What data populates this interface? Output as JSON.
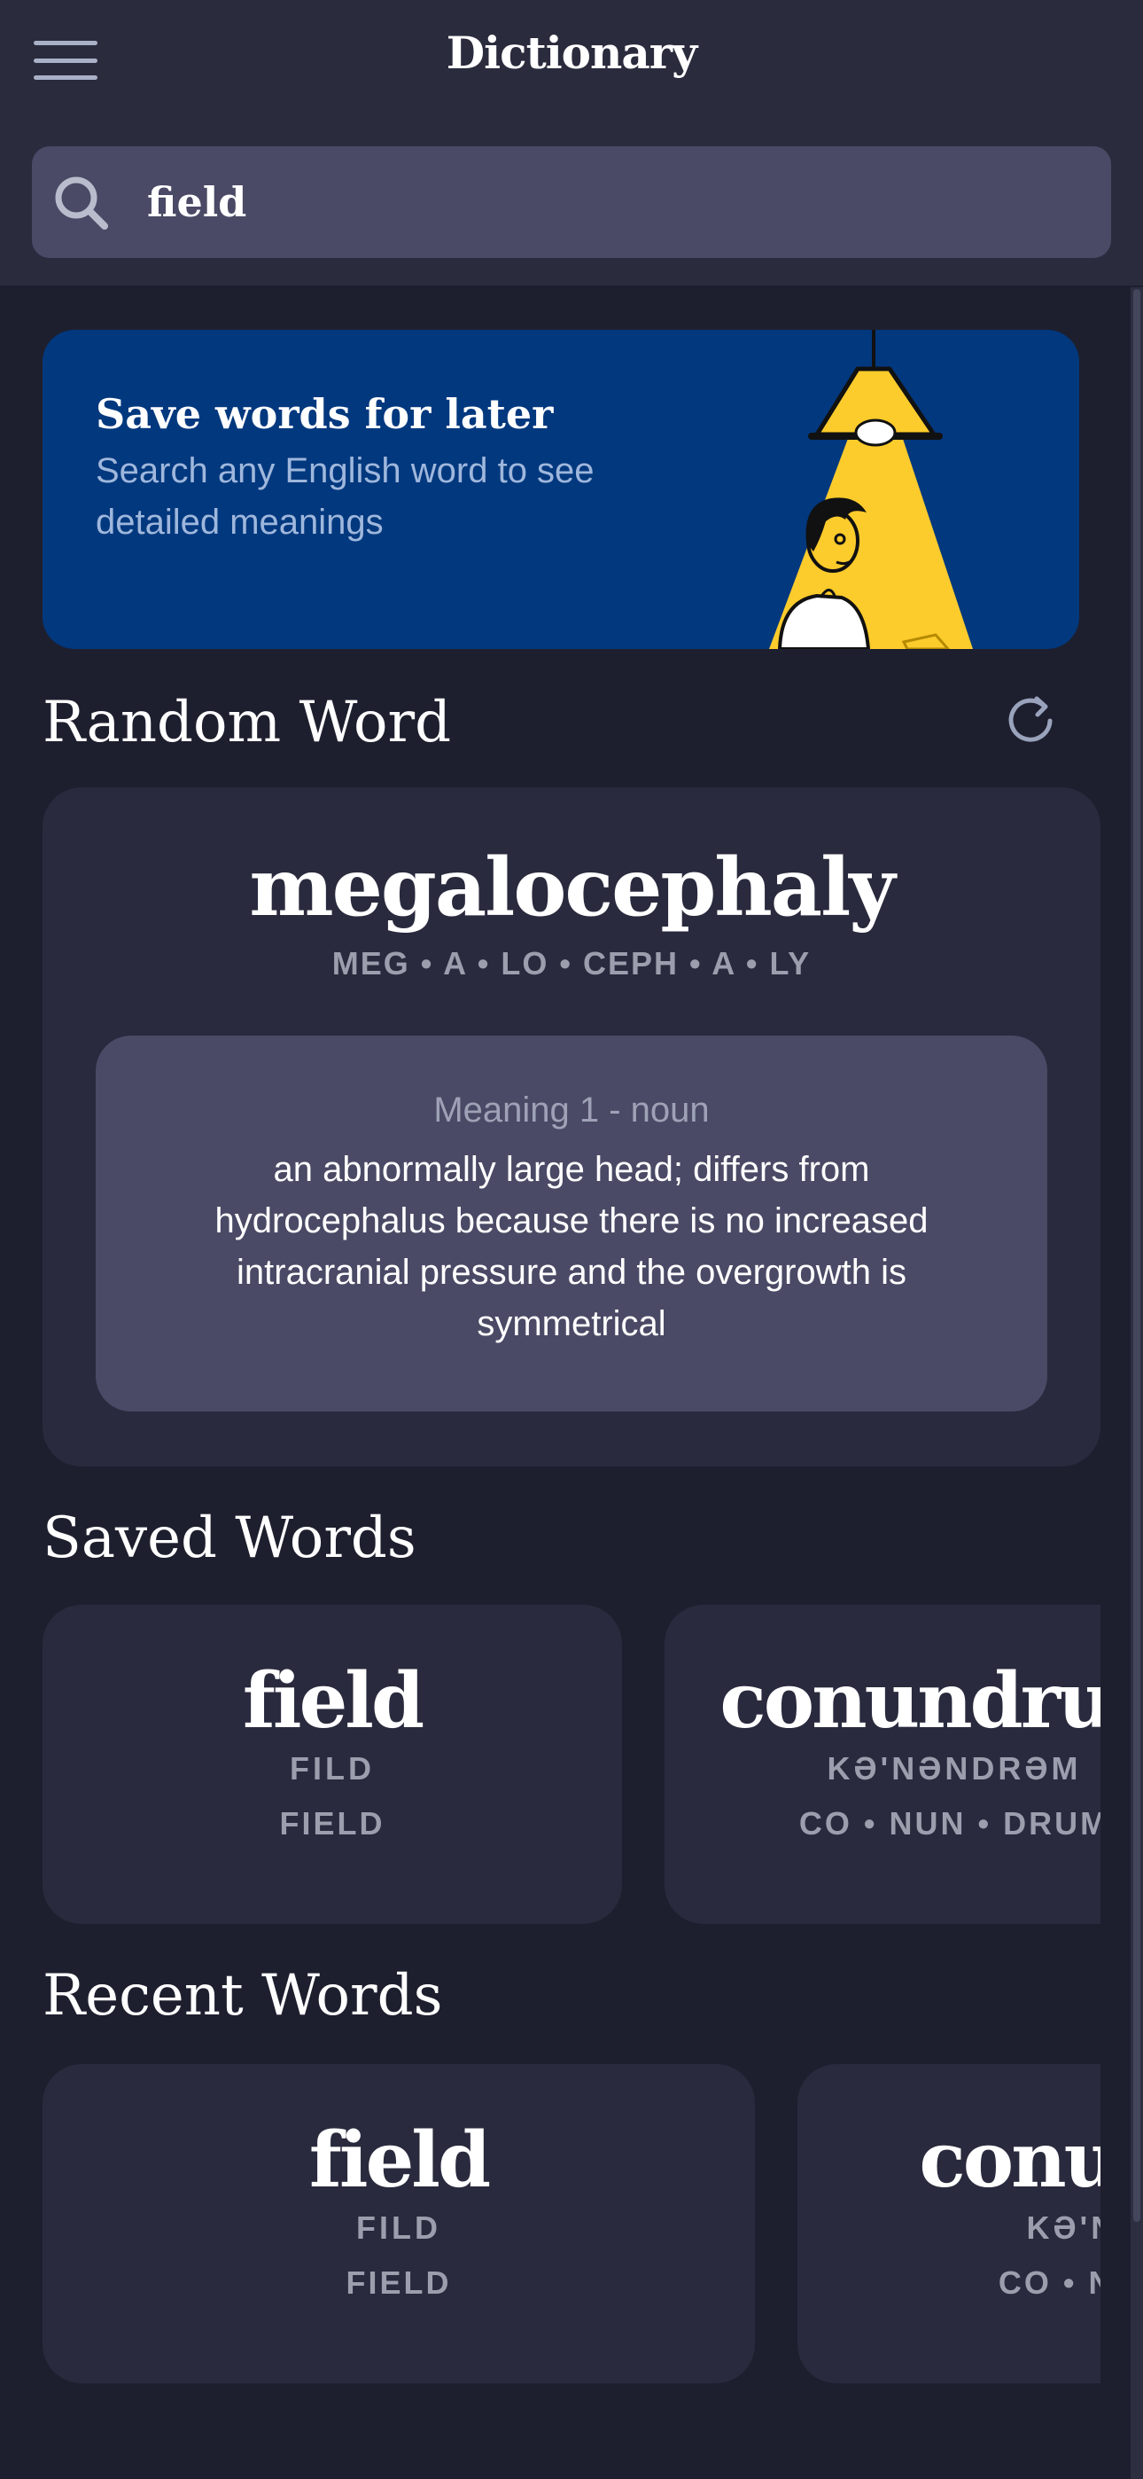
{
  "header": {
    "title": "Dictionary",
    "menu_icon": "hamburger-menu-icon"
  },
  "search": {
    "value": "field",
    "icon": "search-icon"
  },
  "banner": {
    "title": "Save words for later",
    "subtitle": "Search any English word to see detailed meanings",
    "background": "#02387e",
    "illustration": "person-under-lamp-illustration"
  },
  "random_word": {
    "section_title": "Random Word",
    "refresh_icon": "refresh-icon",
    "word": "megalocephaly",
    "syllables": "MEG • A • LO • CEPH • A • LY",
    "meaning_label": "Meaning 1 - noun",
    "meaning_text": "an abnormally large head; differs from hydrocephalus because there is no increased intracranial pressure and the overgrowth is symmetrical"
  },
  "saved_words": {
    "section_title": "Saved Words",
    "items": [
      {
        "word": "field",
        "phonetic": "FILD",
        "syllables": "FIELD"
      },
      {
        "word": "conundrum",
        "phonetic": "KƏ'NƏNDRƏM",
        "syllables": "CO • NUN • DRUM"
      }
    ]
  },
  "recent_words": {
    "section_title": "Recent Words",
    "items": [
      {
        "word": "field",
        "phonetic": "FILD",
        "syllables": "FIELD"
      },
      {
        "word": "conundrum",
        "phonetic": "KƏ'NƏNDRƏM",
        "syllables": "CO • NUN • DRUM"
      }
    ]
  },
  "colors": {
    "background": "#1e1f2e",
    "header": "#2a2b3d",
    "card": "#292a3d",
    "search_field": "#4a4a66",
    "accent_yellow": "#fccb2c",
    "muted_text": "#9c9eae"
  }
}
